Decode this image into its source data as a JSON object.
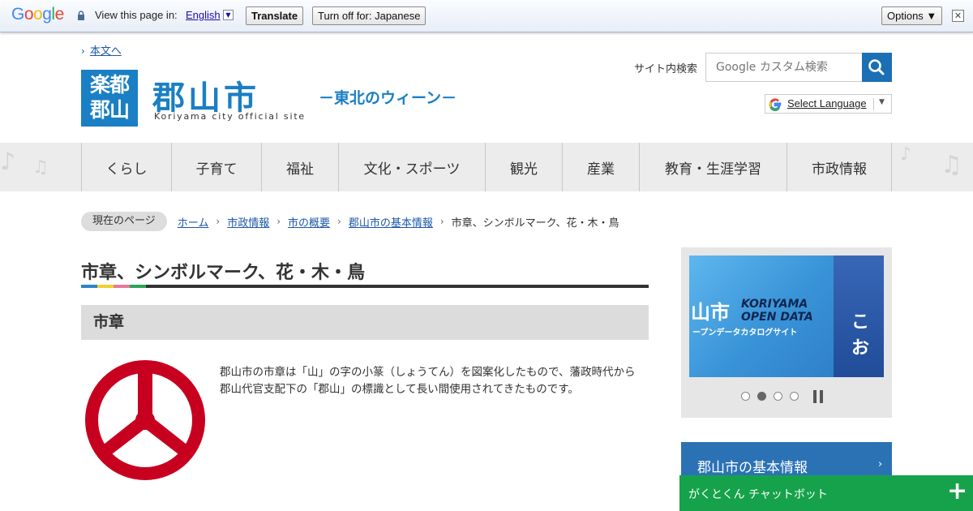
{
  "translate_bar": {
    "logo": "Google",
    "view_text": "View this page in:",
    "language": "English",
    "translate_button": "Translate",
    "turn_off_button": "Turn off for: Japanese",
    "options_button": "Options ▼",
    "close": "✕"
  },
  "header": {
    "skip_link": "本文へ",
    "badge_line1": "楽都",
    "badge_line2": "郡山",
    "city_name": "郡山市",
    "site_sub": "Koriyama city official site",
    "tagline": "－東北のウィーン－",
    "search_label": "サイト内検索",
    "search_placeholder": "Google カスタム検索",
    "select_language": "Select Language"
  },
  "nav": {
    "items": [
      {
        "label": "くらし"
      },
      {
        "label": "子育て"
      },
      {
        "label": "福祉"
      },
      {
        "label": "文化・スポーツ"
      },
      {
        "label": "観光"
      },
      {
        "label": "産業"
      },
      {
        "label": "教育・生涯学習"
      },
      {
        "label": "市政情報"
      }
    ]
  },
  "breadcrumb": {
    "current_label": "現在のページ",
    "links": [
      "ホーム",
      "市政情報",
      "市の概要",
      "郡山市の基本情報"
    ],
    "current": "市章、シンボルマーク、花・木・鳥"
  },
  "main": {
    "title": "市章、シンボルマーク、花・木・鳥",
    "section_heading": "市章",
    "body": "郡山市の市章は「山」の字の小篆（しょうてん）を図案化したもので、藩政時代から郡山代官支配下の「郡山」の標識として長い間使用されてきたものです。",
    "title_rule_colors": [
      "#2a84c9",
      "#f0d02c",
      "#e67a9a",
      "#2aa55a"
    ],
    "emblem_color": "#c8001f"
  },
  "sidebar": {
    "banner": {
      "city": "山市",
      "line1": "KORIYAMA",
      "line2": "OPEN DATA",
      "sub": "ープンデータカタログサイト",
      "right_text": "こお",
      "slide_index": 2,
      "slide_count": 4
    },
    "heading": "郡山市の基本情報"
  },
  "chatbot": {
    "label": "がくとくん チャットボット",
    "plus": "+"
  }
}
